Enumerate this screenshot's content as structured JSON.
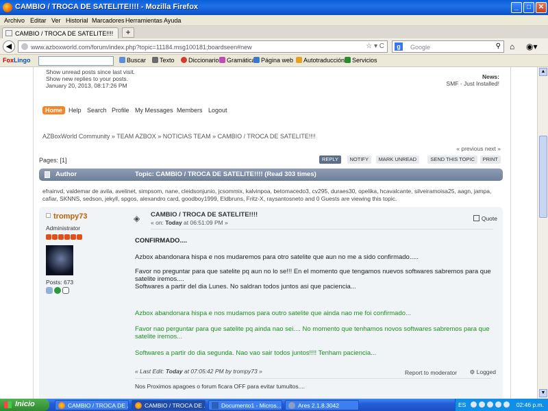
{
  "window": {
    "title": "CAMBIO / TROCA DE SATELITE!!!! - Mozilla Firefox",
    "minimize": "_",
    "maximize": "□",
    "close": "✕"
  },
  "menubar": [
    "Archivo",
    "Editar",
    "Ver",
    "Historial",
    "Marcadores",
    "Herramientas",
    "Ayuda"
  ],
  "tab": {
    "label": "CAMBIO / TROCA DE SATELITE!!!!",
    "new_tab": "+"
  },
  "nav": {
    "url": "www.azboxworld.com/forum/index.php?topic=11184.msg100181;boardseen#new",
    "search_placeholder": "Google",
    "search_engine": "g"
  },
  "foxlingo": {
    "brand_a": "Fox",
    "brand_b": "Lingo",
    "items": [
      "Buscar",
      "Texto",
      "Diccionario",
      "Gramática",
      "Página web",
      "Autotraducción",
      "Servicios"
    ]
  },
  "forum": {
    "show_unread": "Show unread posts since last visit.",
    "show_replies": "Show new replies to your posts.",
    "date": "January 20, 2013, 08:17:26 PM",
    "news_label": "News:",
    "news_text": "SMF - Just Installed!",
    "menu": [
      "Home",
      "Help",
      "Search",
      "Profile",
      "My Messages",
      "Members",
      "Logout"
    ],
    "breadcrumb": "AZBoxWorld Community » TEAM AZBOX » NOTICIAS TEAM » CAMBIO / TROCA DE SATELITE!!!!",
    "prev_next": "« previous next »",
    "pages_label": "Pages: [1]",
    "buttons": [
      "REPLY",
      "NOTIFY",
      "MARK UNREAD",
      "SEND THIS TOPIC",
      "PRINT"
    ],
    "cat_author": "Author",
    "cat_topic": "Topic: CAMBIO / TROCA DE SATELITE!!!!  (Read 303 times)",
    "viewers": "efrainvd, valdemar de avila, avelinet, simpsom, nane, cleidsonjunio, jcsommix, kalvinpoa, betomacedo3, cv295, duraes30, opelika, hcavalcante, silveiramoisa25, aagn, jampa, cafiar, SKNNS, sedson, jekyll, spgos, alexandro card, goodboy1999, Eldbruns, Fritz-X, raysantosneto and 0 Guests are viewing this topic."
  },
  "post": {
    "poster_name": "trompy73",
    "poster_role": "Administrator",
    "post_count": "Posts: 673",
    "subject": "CAMBIO / TROCA DE SATELITE!!!!",
    "on_prefix": "« on: ",
    "on_day": "Today",
    "on_time": " at 06:51:09 PM »",
    "quote": "Quote",
    "lines": {
      "confirm": "CONFIRMADO....",
      "es1": "Azbox abandonara hispa e nos mudaremos para otro satelite que aun no me a sido confirmado.....",
      "es2": "Favor no preguntar para que satelite pq aun no lo se!!!  En el momento que tengamos nuevos softwares sabremos para que satelite iremos....",
      "es3": "Softwares a partir del dia Lunes. No saldran todos juntos asi que paciencia...",
      "pt1": "Azbox abandonara hispa e nos mudamos para outro satelite que ainda nao me foi confirmado...",
      "pt2": "Favor nao perguntar para que satelite pq ainda nao sei.... No momento que tenhamos novos softwares sabremos para que satelite iremos...",
      "pt3": "Softwares a partir do dia segunda. Nao vao sair todos juntos!!!! Tenham paciencia..."
    },
    "last_edit_prefix": "« Last Edit: ",
    "last_edit_day": "Today",
    "last_edit_rest": " at 07:05:42 PM by trompy73 »",
    "report": "Report to moderator",
    "logged": "Logged",
    "signature": "Nos Proximos apagoes o forum ficara OFF para evitar tumultos...."
  },
  "taskbar": {
    "start": "Inicio",
    "tasks": [
      "CAMBIO / TROCA DE ...",
      "CAMBIO / TROCA DE ...",
      "Documento1 - Micros...",
      "Ares 2.1.8.3042"
    ],
    "lang": "ES",
    "clock": "02:46 p.m."
  },
  "colors": {
    "accent": "#f4862a",
    "green_text": "#1e9020",
    "poster_name": "#c06000",
    "cat_bar": "#7a8aa4"
  }
}
